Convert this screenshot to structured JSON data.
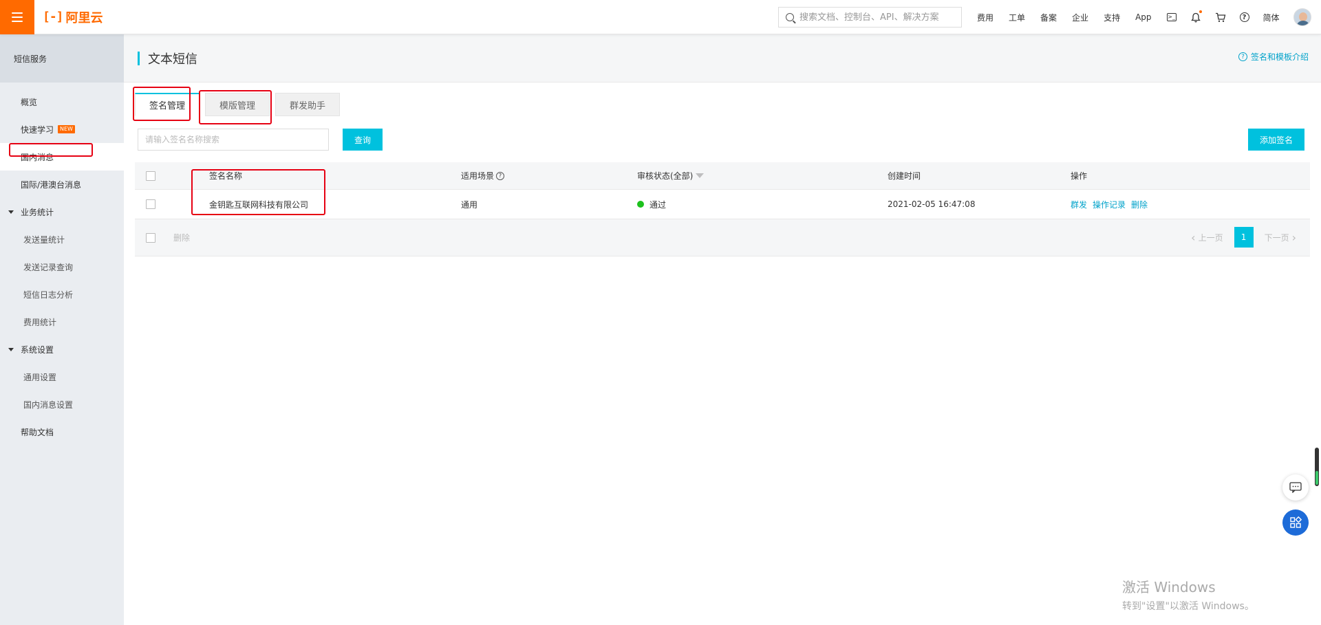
{
  "topbar": {
    "logo_text": "阿里云",
    "logo_mark": "[-]",
    "search_placeholder": "搜索文档、控制台、API、解决方案",
    "nav": [
      "费用",
      "工单",
      "备案",
      "企业",
      "支持",
      "App"
    ],
    "lang": "简体"
  },
  "sidebar": {
    "header": "短信服务",
    "items": {
      "overview": "概览",
      "quick_learn": "快速学习",
      "new_badge": "NEW",
      "domestic": "国内消息",
      "international": "国际/港澳台消息",
      "stats_group": "业务统计",
      "send_stats": "发送量统计",
      "send_records": "发送记录查询",
      "log_analysis": "短信日志分析",
      "cost_stats": "费用统计",
      "settings_group": "系统设置",
      "general_settings": "通用设置",
      "domestic_settings": "国内消息设置",
      "help_docs": "帮助文档"
    }
  },
  "page": {
    "title": "文本短信",
    "help_link": "签名和模板介绍",
    "tabs": [
      "签名管理",
      "模版管理",
      "群发助手"
    ],
    "active_tab": 0,
    "search_placeholder": "请输入签名名称搜索",
    "query_button": "查询",
    "add_button": "添加签名"
  },
  "table": {
    "columns": {
      "name": "签名名称",
      "scene": "适用场景",
      "status": "审核状态(全部)",
      "created": "创建时间",
      "ops": "操作"
    },
    "rows": [
      {
        "name": "金钥匙互联网科技有限公司",
        "scene": "通用",
        "status": "通过",
        "created": "2021-02-05 16:47:08",
        "ops": [
          "群发",
          "操作记录",
          "删除"
        ]
      }
    ],
    "footer": {
      "delete": "删除",
      "prev": "上一页",
      "next": "下一页",
      "current_page": "1"
    }
  },
  "watermark": {
    "line1": "激活 Windows",
    "line2": "转到\"设置\"以激活 Windows。"
  },
  "colors": {
    "brand": "#ff6a00",
    "accent": "#00c1de",
    "link": "#00a2ca",
    "status_ok": "#1dc11d",
    "annotation": "#e60012"
  }
}
